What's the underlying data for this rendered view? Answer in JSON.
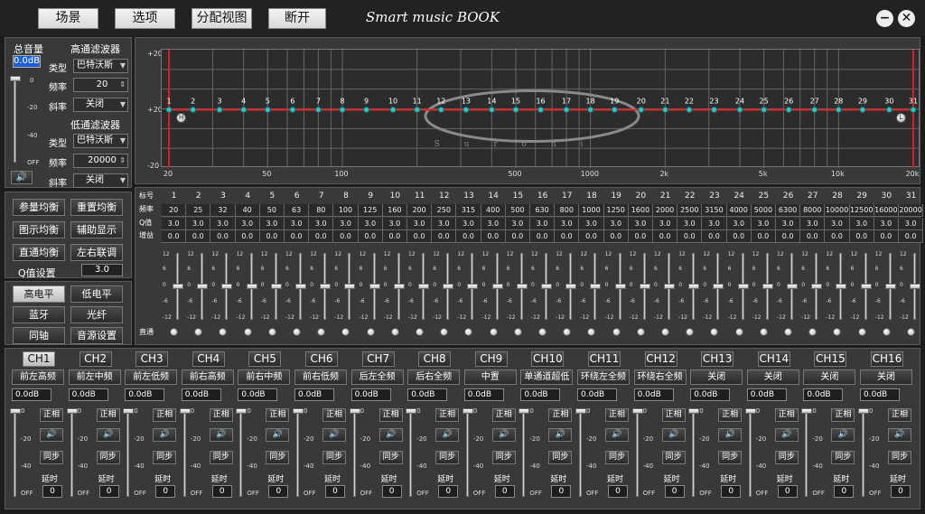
{
  "toolbar": {
    "buttons": [
      "场景",
      "选项",
      "分配视图",
      "断开"
    ],
    "title": "Smart music BOOK",
    "minimize": "−",
    "close": "✕"
  },
  "left": {
    "master_volume_label": "总音量",
    "master_volume_value": "0.0dB",
    "master_scale": [
      "0",
      "-20",
      "-40",
      "OFF"
    ],
    "master_level_pct": 0.0,
    "hp_title": "高通滤波器",
    "lp_title": "低通滤波器",
    "type_label": "类型",
    "freq_label": "频率",
    "slope_label": "斜率",
    "hp_type": "巴特沃斯",
    "hp_freq": "20",
    "hp_slope": "关闭",
    "lp_type": "巴特沃斯",
    "lp_freq": "20000",
    "lp_slope": "关闭"
  },
  "eq_buttons": {
    "param_eq": "参量均衡",
    "reset_eq": "重置均衡",
    "graphic_eq": "图示均衡",
    "aux_display": "辅助显示",
    "bypass_eq": "直通均衡",
    "lr_link": "左右联调",
    "q_label": "Q值设置",
    "q_value": "3.0"
  },
  "input_buttons": {
    "high_level": "高电平",
    "low_level": "低电平",
    "bluetooth": "蓝牙",
    "optical": "光纤",
    "coax": "同轴",
    "source_settings": "音源设置"
  },
  "graph": {
    "y_labels": [
      "+20",
      "+20",
      "-20"
    ],
    "x_labels": [
      "20",
      "50",
      "100",
      "500",
      "1000",
      "2k",
      "5k",
      "10k",
      "20k"
    ],
    "watermark": "S u r o n i",
    "hp_marker": "H",
    "lp_marker": "L"
  },
  "bands": {
    "row_labels": [
      "标号",
      "频率",
      "Q值",
      "增益"
    ],
    "numbers": [
      "1",
      "2",
      "3",
      "4",
      "5",
      "6",
      "7",
      "8",
      "9",
      "10",
      "11",
      "12",
      "13",
      "14",
      "15",
      "16",
      "17",
      "18",
      "19",
      "20",
      "21",
      "22",
      "23",
      "24",
      "25",
      "26",
      "27",
      "28",
      "29",
      "30",
      "31"
    ],
    "freqs": [
      "20",
      "25",
      "32",
      "40",
      "50",
      "63",
      "80",
      "100",
      "125",
      "160",
      "200",
      "250",
      "315",
      "400",
      "500",
      "630",
      "800",
      "1000",
      "1250",
      "1600",
      "2000",
      "2500",
      "3150",
      "4000",
      "5000",
      "6300",
      "8000",
      "10000",
      "12500",
      "16000",
      "20000"
    ],
    "q_values": [
      "3.0",
      "3.0",
      "3.0",
      "3.0",
      "3.0",
      "3.0",
      "3.0",
      "3.0",
      "3.0",
      "3.0",
      "3.0",
      "3.0",
      "3.0",
      "3.0",
      "3.0",
      "3.0",
      "3.0",
      "3.0",
      "3.0",
      "3.0",
      "3.0",
      "3.0",
      "3.0",
      "3.0",
      "3.0",
      "3.0",
      "3.0",
      "3.0",
      "3.0",
      "3.0",
      "3.0"
    ],
    "gains": [
      "0.0",
      "0.0",
      "0.0",
      "0.0",
      "0.0",
      "0.0",
      "0.0",
      "0.0",
      "0.0",
      "0.0",
      "0.0",
      "0.0",
      "0.0",
      "0.0",
      "0.0",
      "0.0",
      "0.0",
      "0.0",
      "0.0",
      "0.0",
      "0.0",
      "0.0",
      "0.0",
      "0.0",
      "0.0",
      "0.0",
      "0.0",
      "0.0",
      "0.0",
      "0.0",
      "0.0"
    ],
    "slider_scale": [
      "12",
      "6",
      "0",
      "-6",
      "-12"
    ],
    "bypass_label": "直通"
  },
  "channels": {
    "names": [
      "CH1",
      "CH2",
      "CH3",
      "CH4",
      "CH5",
      "CH6",
      "CH7",
      "CH8",
      "CH9",
      "CH10",
      "CH11",
      "CH12",
      "CH13",
      "CH14",
      "CH15",
      "CH16"
    ],
    "active_index": 0,
    "assignments": [
      "前左高频",
      "前左中频",
      "前左低频",
      "前右高频",
      "前右中频",
      "前右低频",
      "后左全频",
      "后右全频",
      "中置",
      "单通道超低",
      "环绕左全频",
      "环绕右全频",
      "关闭",
      "关闭",
      "关闭",
      "关闭"
    ],
    "level": "0.0dB",
    "scale": [
      "0",
      "-20",
      "-40",
      "OFF"
    ],
    "phase_label": "正相",
    "sync_label": "同步",
    "delay_label": "延时",
    "delay_value": "0"
  }
}
